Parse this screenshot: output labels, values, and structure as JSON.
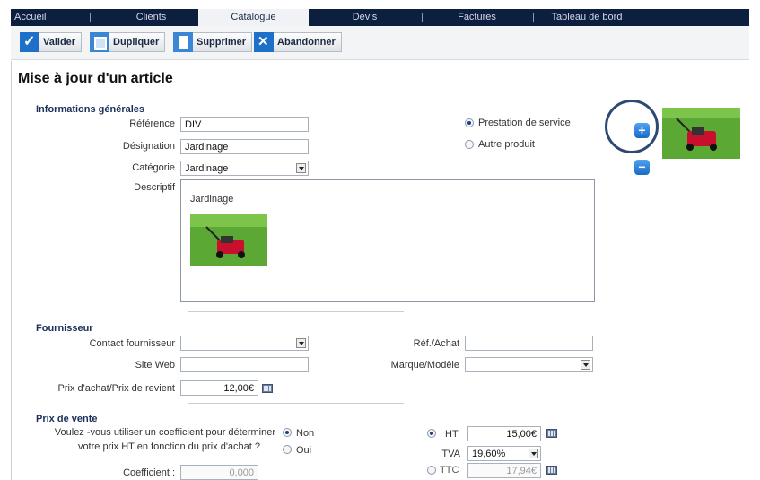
{
  "nav": {
    "tabs": [
      "Accueil",
      "Clients",
      "Catalogue",
      "Devis",
      "Factures",
      "Tableau de bord"
    ],
    "active": "Catalogue"
  },
  "toolbar": {
    "validate": "Valider",
    "duplicate": "Dupliquer",
    "delete": "Supprimer",
    "cancel": "Abandonner"
  },
  "page": {
    "title": "Mise à jour d'un article"
  },
  "general": {
    "section": "Informations générales",
    "reference_label": "Référence",
    "reference_value": "DIV",
    "designation_label": "Désignation",
    "designation_value": "Jardinage",
    "category_label": "Catégorie",
    "category_value": "Jardinage",
    "description_label": "Descriptif",
    "description_text": "Jardinage",
    "type_service": "Prestation de service",
    "type_other": "Autre produit",
    "type_selected": "Prestation de service"
  },
  "supplier": {
    "section": "Fournisseur",
    "contact_label": "Contact fournisseur",
    "contact_value": "",
    "website_label": "Site Web",
    "website_value": "",
    "purchase_label": "Prix d'achat/Prix de revient",
    "purchase_value": "12,00€",
    "ref_label": "Réf./Achat",
    "ref_value": "",
    "brand_label": "Marque/Modèle",
    "brand_value": ""
  },
  "sale": {
    "section": "Prix de vente",
    "question_line1": "Voulez -vous utiliser un coefficient pour déterminer",
    "question_line2": "votre prix HT en fonction du prix d'achat ?",
    "no_label": "Non",
    "yes_label": "Oui",
    "use_coefficient": "Non",
    "coefficient_label": "Coefficient :",
    "coefficient_value": "0,000",
    "ht_label": "HT",
    "ht_value": "15,00€",
    "tva_label": "TVA",
    "tva_value": "19,60%",
    "ttc_label": "TTC",
    "ttc_value": "17,94€",
    "price_mode": "HT"
  },
  "icons": {
    "add": "plus-icon",
    "remove": "minus-icon",
    "calculator": "calculator-icon"
  },
  "colors": {
    "nav_bg": "#0c1f3f",
    "accent": "#1e6fc7",
    "section_title": "#1b2f5a",
    "highlight_circle": "#2d4a73"
  }
}
